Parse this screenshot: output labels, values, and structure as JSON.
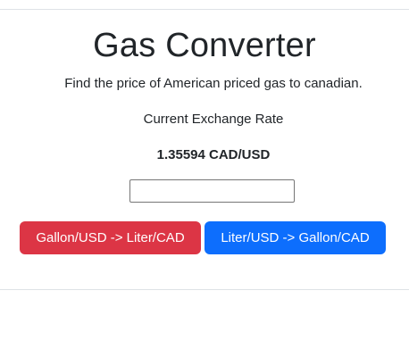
{
  "header": {
    "title": "Gas Converter",
    "subtitle": "Find the price of American priced gas to canadian."
  },
  "exchange": {
    "label": "Current Exchange Rate",
    "value": "1.35594 CAD/USD"
  },
  "converter": {
    "input_value": "",
    "input_placeholder": ""
  },
  "buttons": {
    "gallon_to_liter": "Gallon/USD -> Liter/CAD",
    "liter_to_gallon": "Liter/USD -> Gallon/CAD"
  },
  "colors": {
    "danger": "#dc3545",
    "primary": "#0d6efd",
    "divider": "#dee2e6",
    "text": "#212529"
  }
}
